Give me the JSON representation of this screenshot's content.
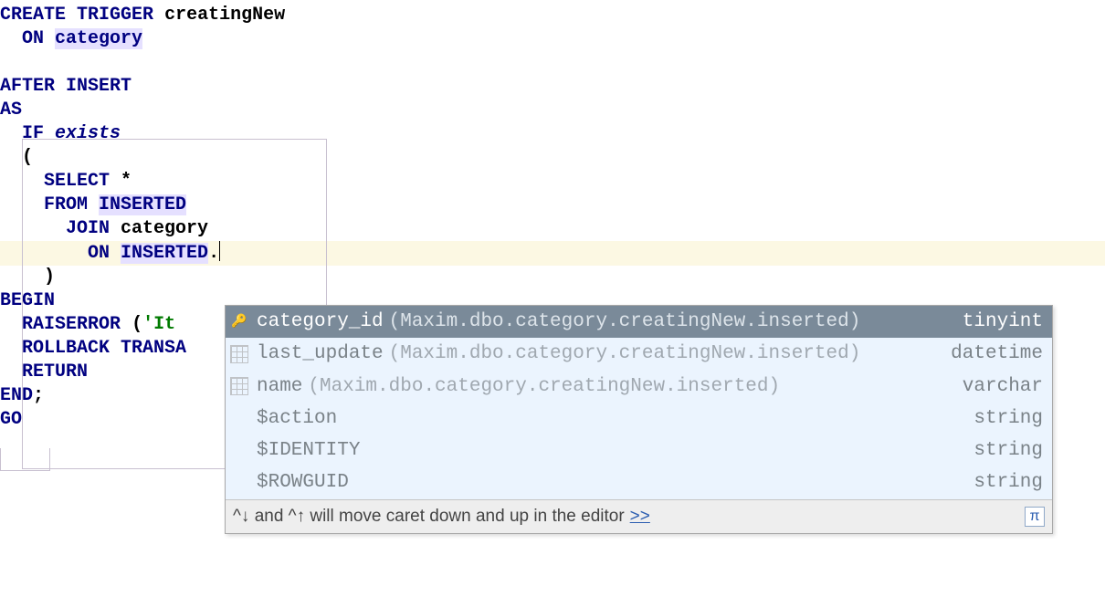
{
  "code": {
    "line1_kw1": "CREATE",
    "line1_kw2": "TRIGGER",
    "line1_name": "creatingNew",
    "line2_kw": "ON",
    "line2_hl": "category",
    "line4_kw1": "AFTER",
    "line4_kw2": "INSERT",
    "line5_kw": "AS",
    "line6_kw": "IF",
    "line6_fn": "exists",
    "line7": "(",
    "line8_kw": "SELECT",
    "line8_op": "*",
    "line9_kw": "FROM",
    "line9_hl": "INSERTED",
    "line10_kw": "JOIN",
    "line10_name": "category",
    "line11_kw": "ON",
    "line11_hl": "INSERTED",
    "line11_dot": ".",
    "line12": ")",
    "line13_kw": "BEGIN",
    "line14_kw": "RAISERROR",
    "line14_paren": "(",
    "line14_str": "'It",
    "line15_kw": "ROLLBACK",
    "line15_kw2": "TRANSA",
    "line16_kw": "RETURN",
    "line17_kw": "END",
    "line17_semi": ";",
    "line18_kw": "GO"
  },
  "popup": {
    "items": [
      {
        "name": "category_id",
        "source": "(Maxim.dbo.category.creatingNew.inserted)",
        "type": "tinyint",
        "icon": "key",
        "selected": true
      },
      {
        "name": "last_update",
        "source": "(Maxim.dbo.category.creatingNew.inserted)",
        "type": "datetime",
        "icon": "grid",
        "selected": false
      },
      {
        "name": "name",
        "source": "(Maxim.dbo.category.creatingNew.inserted)",
        "type": "varchar",
        "icon": "grid",
        "selected": false
      },
      {
        "name": "$action",
        "source": "",
        "type": "string",
        "icon": "none",
        "selected": false
      },
      {
        "name": "$IDENTITY",
        "source": "",
        "type": "string",
        "icon": "none",
        "selected": false
      },
      {
        "name": "$ROWGUID",
        "source": "",
        "type": "string",
        "icon": "none",
        "selected": false
      }
    ],
    "footer_text": "^↓ and ^↑ will move caret down and up in the editor ",
    "footer_link": ">>"
  }
}
